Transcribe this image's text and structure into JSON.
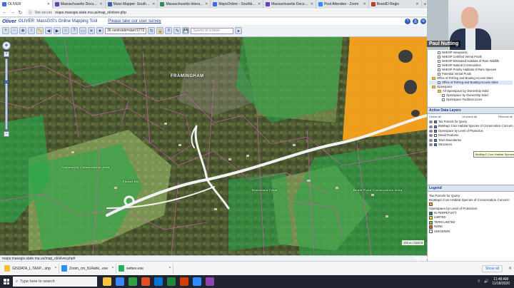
{
  "browser": {
    "tabs": [
      {
        "label": "OLIVER",
        "color": "#3a6fd8",
        "active": true
      },
      {
        "label": "Massachusetts Document",
        "color": "#6a3fb5",
        "active": false
      },
      {
        "label": "Mass Mapper: Southboro",
        "color": "#3f5fa8",
        "active": false
      },
      {
        "label": "Massachusetts Interactive",
        "color": "#2e8b57",
        "active": false
      },
      {
        "label": "MapsOnline - Southborough",
        "color": "#3a6fd8",
        "active": false
      },
      {
        "label": "Massachusetts Document",
        "color": "#6a3fb5",
        "active": false
      },
      {
        "label": "Post Attendee - Zoom",
        "color": "#2d8cff",
        "active": false
      },
      {
        "label": "BoardD Regis",
        "color": "#c0392b",
        "active": false
      }
    ],
    "not_secure": "Not secure",
    "url": "maps.massgis.state.ma.us/map_ol/oliver.php"
  },
  "app": {
    "logo": "Oliver",
    "title": "OLIVER: MassGIS's Online Mapping Tool",
    "survey_link": "Please take our user survey",
    "scale_select": "36 centroids=start 5772",
    "search_placeholder": "Survey to a town"
  },
  "map": {
    "labels": {
      "framingham": "FRAMINGHAM",
      "small1": "Community Conservation Area",
      "small2": "Blanchard Farm",
      "small3": "Beals Pond Conservation Area",
      "small4": "Forest Rd"
    },
    "scale": "200 m / 1000 ft",
    "status_url": "maps.massgis.state.ma.us/map_ol/oliver.php#",
    "status_coord": ""
  },
  "webcam": {
    "name": "Paul Nutting"
  },
  "layer_tree": [
    {
      "label": "NHESP Viewpoints",
      "level": 2,
      "type": "box"
    },
    {
      "label": "NHESP Certified Vernal Pools",
      "level": 2,
      "type": "box"
    },
    {
      "label": "NHESP Estimated Habitats of Rare Wildlife",
      "level": 2,
      "type": "box"
    },
    {
      "label": "NHESP Natural Communities",
      "level": 2,
      "type": "box"
    },
    {
      "label": "NHESP Priority Habitats of Rare Species",
      "level": 2,
      "type": "box"
    },
    {
      "label": "Potential Vernal Pools",
      "level": 2,
      "type": "box"
    },
    {
      "label": "Office of Fishing and Boating Access Sites",
      "level": 1,
      "type": "folder"
    },
    {
      "label": "Office of Fishing and Boating Access Sites",
      "level": 2,
      "type": "box",
      "highlight": true
    },
    {
      "label": "Openspace",
      "level": 1,
      "type": "folder"
    },
    {
      "label": "All Openspace by Ownership Solid",
      "level": 2,
      "type": "folder"
    },
    {
      "label": "Openspace by Ownership Solid",
      "level": 3,
      "type": "box"
    },
    {
      "label": "Openspace Facilities Lines",
      "level": 3,
      "type": "box"
    }
  ],
  "active_layers": {
    "header": "Active Data Layers",
    "check_all": "Check all",
    "uncheck_all": "Uncheck all",
    "remove_all": "Remove all",
    "rows": [
      {
        "label": "Tax Parcels for Query",
        "checked": true
      },
      {
        "label": "BioMap2 Core Habitat Species of Conservation Concern",
        "checked": true
      },
      {
        "label": "Openspace by Level of Protection",
        "checked": true
      },
      {
        "label": "Detail Features",
        "checked": false
      },
      {
        "label": "Town Boundaries",
        "checked": true
      },
      {
        "label": "Structures",
        "checked": true
      }
    ],
    "tooltip": "BioMap2 Core Habitat Species of"
  },
  "legend": {
    "header": "Legend",
    "title1": "Tax Parcels for Query",
    "title2": "BioMap2 Core Habitat Species of Conservation Concern",
    "title3": "Openspace by Level of Protection",
    "items": [
      {
        "label": "IN PERPETUITY",
        "color": "#1f8a3b"
      },
      {
        "label": "LIMITED",
        "color": "#e6e600"
      },
      {
        "label": "TERM LIMITED",
        "color": "#5fd35f"
      },
      {
        "label": "NONE",
        "color": "#e74c3c"
      },
      {
        "label": "UNKNOWN",
        "color": "#ffffff"
      }
    ]
  },
  "zoom_watermark": "zoom",
  "downloads": [
    {
      "name": "GISDATA_L.TAXP....shp",
      "color": "#f0c040"
    },
    {
      "name": "Zoom_cm_NJ4ahk...exe",
      "color": "#2d8cff"
    },
    {
      "name": "webex.exe",
      "color": "#27ae60"
    }
  ],
  "show_all": "Show all",
  "taskbar": {
    "search": "Type here to search",
    "apps": [
      "#f5c542",
      "#3a86ff",
      "#2ea043",
      "#e34c26",
      "#0078d4",
      "#1f8a3b",
      "#d83b01",
      "#2d8cff",
      "#8e44ad"
    ],
    "time": "11:48 AM",
    "date": "11/18/2020"
  }
}
